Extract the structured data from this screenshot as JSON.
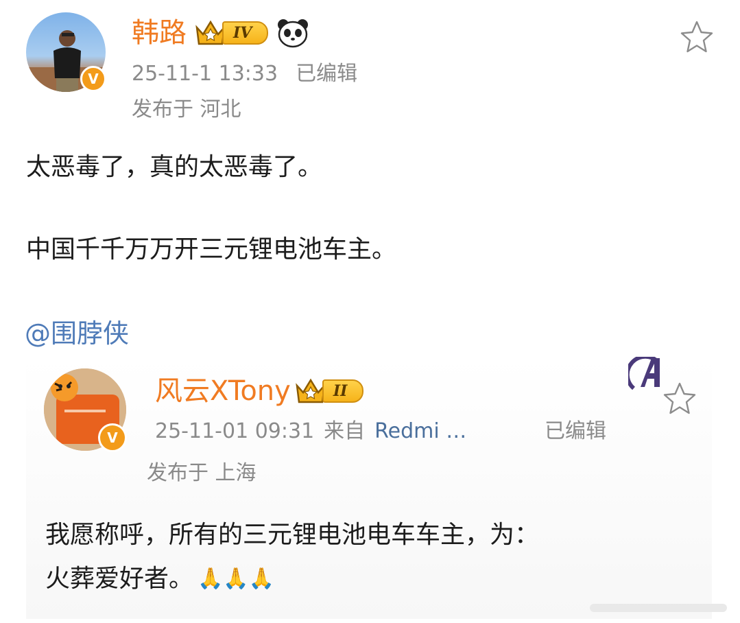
{
  "post": {
    "author_name": "韩路",
    "level": "IV",
    "timestamp": "25-11-1 13:33",
    "edited": "已编辑",
    "location": "发布于 河北",
    "lines": [
      "太恶毒了，真的太恶毒了。",
      "中国千千万万开三元锂电池车主。"
    ],
    "mention": "@围脖侠"
  },
  "quoted": {
    "author_name": "风云XTony",
    "level": "II",
    "timestamp": "25-11-01 09:31",
    "source_prefix": "来自",
    "source_device": "Redmi …",
    "edited": "已编辑",
    "location": "发布于 上海",
    "line1": "我愿称呼，所有的三元锂电池电车车主，为：",
    "line2": "火葬爱好者。",
    "emoji": "🙏🙏🙏"
  },
  "icons": {
    "favorite": "star-outline-icon",
    "verified": "v-verified-icon",
    "crown": "crown-icon",
    "panda": "panda-icon",
    "avengers": "avengers-icon"
  },
  "colors": {
    "name": "#f07b22",
    "meta": "#8a8a8a",
    "mention": "#4f7bb8",
    "verified": "#f39b1a"
  }
}
